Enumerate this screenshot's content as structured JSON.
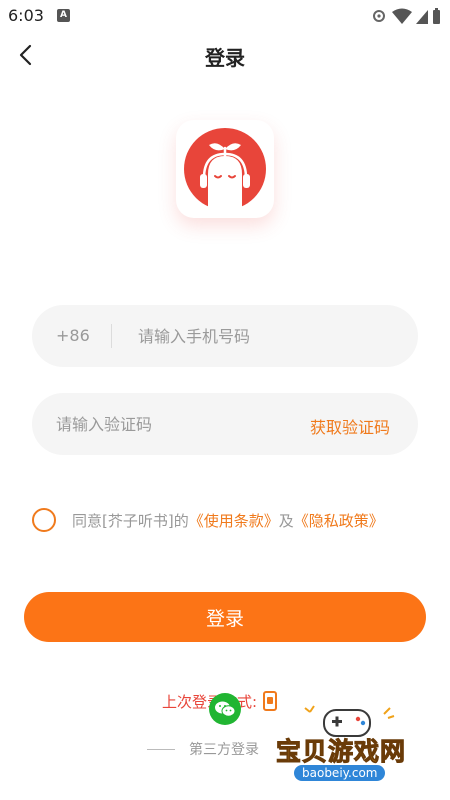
{
  "status_bar": {
    "time": "6:03",
    "notification_letter": "A",
    "icons": [
      "settings-gear-icon",
      "wifi-icon",
      "signal-icon",
      "battery-icon"
    ]
  },
  "nav": {
    "title": "登录",
    "back_icon": "chevron-left-icon"
  },
  "logo": {
    "icon": "app-logo-icon",
    "colors": {
      "primary": "#e8453a",
      "face": "#ffffff"
    }
  },
  "phone_field": {
    "country_code": "+86",
    "value": "",
    "placeholder": "请输入手机号码"
  },
  "code_field": {
    "value": "",
    "placeholder": "请输入验证码",
    "get_code_label": "获取验证码"
  },
  "agreement": {
    "checked": false,
    "prefix": "同意[芥子听书]的",
    "terms_link": "《使用条款》",
    "connector": "及",
    "privacy_link": "《隐私政策》"
  },
  "login_button": {
    "label": "登录"
  },
  "last_login": {
    "label": "上次登录方式:",
    "method_icon": "phone-icon"
  },
  "wechat": {
    "icon": "wechat-icon"
  },
  "third_party": {
    "label": "第三方登录"
  },
  "watermark": {
    "title": "宝贝游戏网",
    "url": "baobeiy.com"
  },
  "colors": {
    "accent": "#f07a1c",
    "button": "#fc7416",
    "last_login_text": "#e8453a",
    "wechat": "#21b532",
    "field_bg": "#f5f5f5"
  }
}
